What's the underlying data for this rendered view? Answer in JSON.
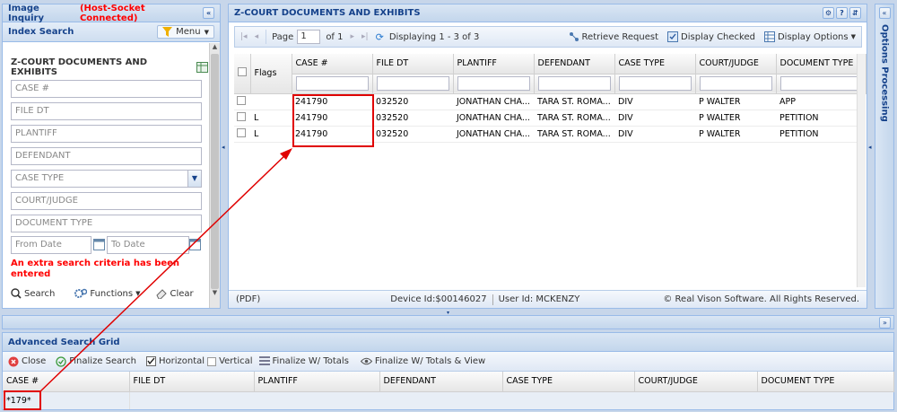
{
  "left": {
    "title": "Image Inquiry",
    "status": "(Host-Socket Connected)",
    "index_search": "Index Search",
    "menu": "Menu",
    "section": "Z-COURT DOCUMENTS AND EXHIBITS",
    "fields": {
      "case": "CASE #",
      "file_dt": "FILE DT",
      "plantiff": "PLANTIFF",
      "defendant": "DEFENDANT",
      "case_type": "CASE TYPE",
      "court_judge": "COURT/JUDGE",
      "document_type": "DOCUMENT TYPE",
      "from_date": "From Date",
      "to_date": "To Date"
    },
    "error": "An extra search criteria has been entered",
    "search": "Search",
    "functions": "Functions",
    "clear": "Clear"
  },
  "main": {
    "title": "Z-COURT DOCUMENTS AND EXHIBITS",
    "page_label": "Page",
    "page": "1",
    "of": "of 1",
    "displaying": "Displaying 1 - 3 of 3",
    "retrieve": "Retrieve Request",
    "display_checked": "Display Checked",
    "display_options": "Display Options",
    "columns": [
      "Flags",
      "CASE #",
      "FILE DT",
      "PLANTIFF",
      "DEFENDANT",
      "CASE TYPE",
      "COURT/JUDGE",
      "DOCUMENT TYPE"
    ],
    "rows": [
      {
        "flag": "",
        "case": "241790",
        "file_dt": "032520",
        "plantiff": "JONATHAN CHA...",
        "defendant": "TARA ST. ROMA...",
        "case_type": "DIV",
        "court": "P WALTER",
        "doc": "APP"
      },
      {
        "flag": "L",
        "case": "241790",
        "file_dt": "032520",
        "plantiff": "JONATHAN CHA...",
        "defendant": "TARA ST. ROMA...",
        "case_type": "DIV",
        "court": "P WALTER",
        "doc": "PETITION"
      },
      {
        "flag": "L",
        "case": "241790",
        "file_dt": "032520",
        "plantiff": "JONATHAN CHA...",
        "defendant": "TARA ST. ROMA...",
        "case_type": "DIV",
        "court": "P WALTER",
        "doc": "PETITION"
      }
    ],
    "footer_pdf": "(PDF)",
    "device": "Device Id:$00146027",
    "user": "User Id: MCKENZY",
    "copyright": "© Real Vison Software. All Rights Reserved."
  },
  "right": {
    "title": "Options Processing"
  },
  "adv": {
    "title": "Advanced Search Grid",
    "close": "Close",
    "finalize": "Finalize Search",
    "horizontal": "Horizontal",
    "vertical": "Vertical",
    "totals": "Finalize W/ Totals",
    "totals_view": "Finalize W/ Totals & View",
    "columns": [
      "CASE #",
      "FILE DT",
      "PLANTIFF",
      "DEFENDANT",
      "CASE TYPE",
      "COURT/JUDGE",
      "DOCUMENT TYPE"
    ],
    "value": "*179*"
  },
  "colors": {
    "error": "#ff0000",
    "accent": "#15428b",
    "highlight": "#e00000"
  }
}
